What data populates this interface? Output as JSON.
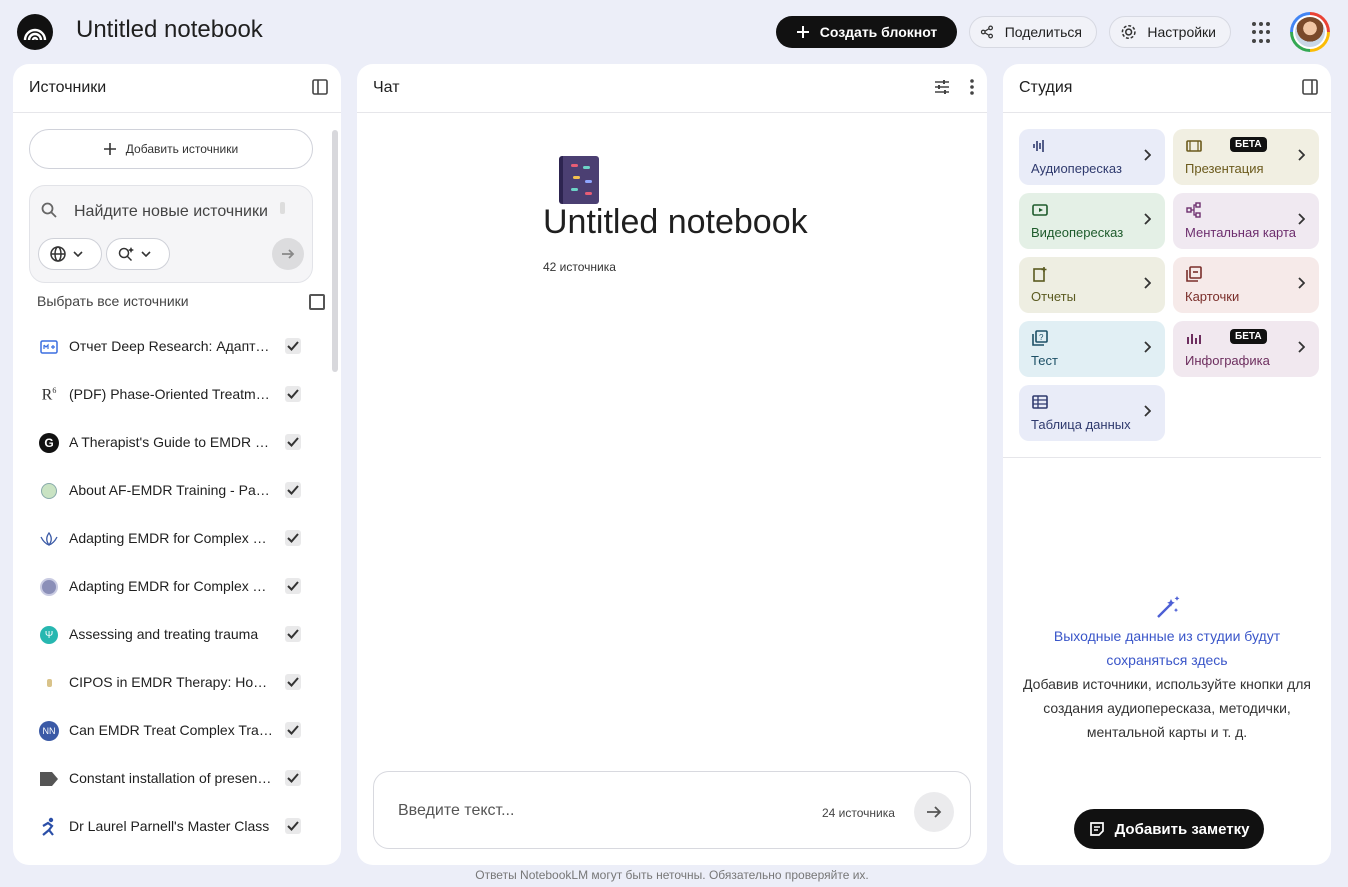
{
  "header": {
    "title": "Untitled notebook",
    "create_label": "Создать блокнот",
    "share_label": "Поделиться",
    "settings_label": "Настройки"
  },
  "sources": {
    "title": "Источники",
    "add_label": "Добавить источники",
    "search_placeholder": "Найдите новые источники",
    "select_all_label": "Выбрать все источники",
    "items": [
      {
        "title": "Отчет Deep Research: Адаптация EMDR",
        "icon": "document-icon",
        "checked": true
      },
      {
        "title": "(PDF) Phase-Oriented Treatment",
        "icon": "researchgate-icon",
        "checked": true
      },
      {
        "title": "A Therapist's Guide to EMDR - Google Books",
        "icon": "g-icon",
        "checked": true
      },
      {
        "title": "About AF-EMDR Training - Parnell Institute",
        "icon": "tree-icon",
        "checked": true
      },
      {
        "title": "Adapting EMDR for Complex PTSD",
        "icon": "lotus-icon",
        "checked": true
      },
      {
        "title": "Adapting EMDR for Complex Trauma",
        "icon": "globe-icon",
        "checked": true
      },
      {
        "title": "Assessing and treating trauma",
        "icon": "teal-circle-icon",
        "checked": true
      },
      {
        "title": "CIPOS in EMDR Therapy: How It Works",
        "icon": "small-dot-icon",
        "checked": true
      },
      {
        "title": "Can EMDR Treat Complex Trauma?",
        "icon": "nn-icon",
        "checked": true
      },
      {
        "title": "Constant installation of present orientation",
        "icon": "tag-icon",
        "checked": true
      },
      {
        "title": "Dr Laurel Parnell's Master Class",
        "icon": "runner-icon",
        "checked": true
      }
    ]
  },
  "chat": {
    "title": "Чат",
    "notebook_title": "Untitled notebook",
    "source_count": "42 источника",
    "input_placeholder": "Введите текст...",
    "input_source_count": "24 источника"
  },
  "studio": {
    "title": "Студия",
    "beta_label": "БЕТА",
    "tiles": [
      {
        "label": "Аудиопересказ",
        "icon": "audio-wave-icon",
        "color": "#e9ecf8",
        "text_color": "#2f3a6e",
        "beta": false
      },
      {
        "label": "Презентация",
        "icon": "slides-icon",
        "color": "#f1efe2",
        "text_color": "#6b5a1c",
        "beta": true
      },
      {
        "label": "Видеопересказ",
        "icon": "video-icon",
        "color": "#e4f0e6",
        "text_color": "#1e5b2c",
        "beta": false
      },
      {
        "label": "Ментальная карта",
        "icon": "mindmap-icon",
        "color": "#f0e9f1",
        "text_color": "#6d2e6e",
        "beta": false
      },
      {
        "label": "Отчеты",
        "icon": "report-icon",
        "color": "#eeeee2",
        "text_color": "#5a5a20",
        "beta": false
      },
      {
        "label": "Карточки",
        "icon": "flashcards-icon",
        "color": "#f6eae9",
        "text_color": "#7a2e2a",
        "beta": false
      },
      {
        "label": "Тест",
        "icon": "quiz-icon",
        "color": "#e1eff4",
        "text_color": "#1d5066",
        "beta": false
      },
      {
        "label": "Инфографика",
        "icon": "infographic-icon",
        "color": "#f1e8ef",
        "text_color": "#6d2e5e",
        "beta": true
      },
      {
        "label": "Таблица данных",
        "icon": "table-icon",
        "color": "#e9ecf8",
        "text_color": "#2f3a6e",
        "beta": false
      }
    ],
    "empty_title": "Выходные данные из студии будут сохраняться здесь",
    "empty_desc": "Добавив источники, используйте кнопки для создания аудиопересказа, методички, ментальной карты и т. д.",
    "add_note_label": "Добавить заметку"
  },
  "footer": "Ответы NotebookLM могут быть неточны. Обязательно проверяйте их."
}
